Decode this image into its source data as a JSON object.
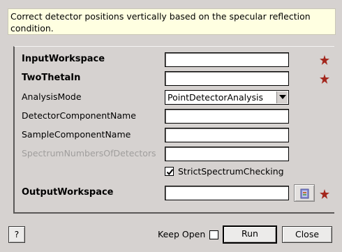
{
  "description": "Correct detector positions vertically based on the specular reflection condition.",
  "properties": [
    {
      "name": "InputWorkspace",
      "value": ""
    },
    {
      "name": "TwoThetaIn",
      "value": ""
    },
    {
      "name": "AnalysisMode",
      "value": "PointDetectorAnalysis"
    },
    {
      "name": "DetectorComponentName",
      "value": ""
    },
    {
      "name": "SampleComponentName",
      "value": ""
    },
    {
      "name": "SpectrumNumbersOfDetectors",
      "value": ""
    },
    {
      "name": "StrictSpectrumChecking",
      "checked": true
    },
    {
      "name": "OutputWorkspace",
      "value": ""
    }
  ],
  "footer": {
    "help_label": "?",
    "keep_open_label": "Keep Open",
    "keep_open_checked": false,
    "run_label": "Run",
    "close_label": "Close"
  },
  "colors": {
    "background": "#d6d2d0",
    "description_bg": "#ffffe1",
    "required_star": "#a3261c"
  },
  "icons": {
    "required": "required-star-icon",
    "browse": "workspace-browse-icon",
    "dropdown": "chevron-down-icon",
    "check": "checkmark-icon"
  }
}
